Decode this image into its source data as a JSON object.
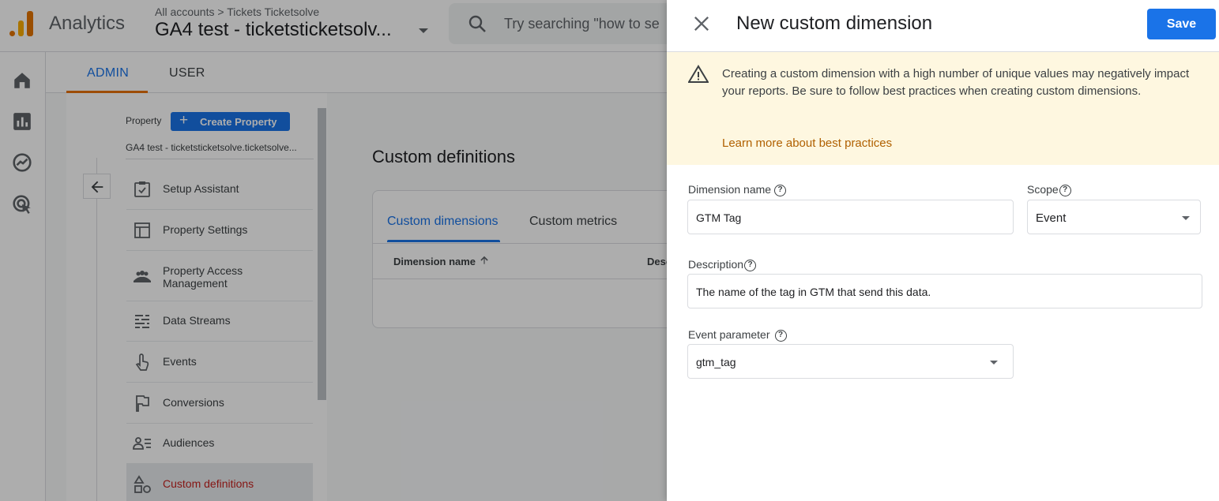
{
  "header": {
    "app_name": "Analytics",
    "breadcrumb_all": "All accounts",
    "breadcrumb_sep": ">",
    "breadcrumb_account": "Tickets Ticketsolve",
    "property_title": "GA4 test - ticketsticketsolv...",
    "search_placeholder": "Try searching \"how to se"
  },
  "tabs": [
    {
      "label": "ADMIN",
      "active": true
    },
    {
      "label": "USER",
      "active": false
    }
  ],
  "property_panel": {
    "label": "Property",
    "create_button": "Create Property",
    "property_name": "GA4 test - ticketsticketsolve.ticketsolve...",
    "menu": [
      {
        "label": "Setup Assistant",
        "icon": "checklist-icon"
      },
      {
        "label": "Property Settings",
        "icon": "layout-icon"
      },
      {
        "label": "Property Access Management",
        "icon": "people-icon"
      },
      {
        "label": "Data Streams",
        "icon": "data-streams-icon"
      },
      {
        "label": "Events",
        "icon": "touch-icon"
      },
      {
        "label": "Conversions",
        "icon": "flag-icon"
      },
      {
        "label": "Audiences",
        "icon": "audience-icon"
      },
      {
        "label": "Custom definitions",
        "icon": "shapes-icon",
        "active": true
      }
    ]
  },
  "custom_definitions": {
    "title": "Custom definitions",
    "tabs": [
      "Custom dimensions",
      "Custom metrics"
    ],
    "columns": [
      "Dimension name",
      "Desc"
    ]
  },
  "sheet": {
    "title": "New custom dimension",
    "save_label": "Save",
    "warning_text": "Creating a custom dimension with a high number of unique values may negatively impact your reports. Be sure to follow best practices when creating custom dimensions.",
    "warning_link": "Learn more about best practices",
    "dimension_name_label": "Dimension name",
    "dimension_name_value": "GTM Tag",
    "scope_label": "Scope",
    "scope_value": "Event",
    "description_label": "Description",
    "description_value": "The name of the tag in GTM that send this data.",
    "event_param_label": "Event parameter",
    "event_param_value": "gtm_tag",
    "help_glyph": "?"
  },
  "colors": {
    "primary": "#1a73e8",
    "warning_bg": "#fef7e0",
    "warning_link": "#b06000",
    "active_menu": "#c5221f",
    "admin_underline": "#e8710a"
  }
}
